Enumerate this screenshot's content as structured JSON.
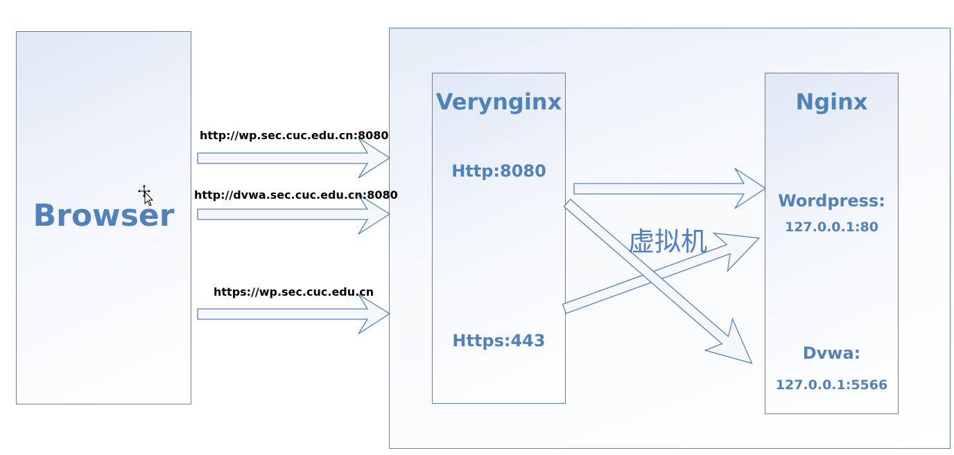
{
  "browser": {
    "label": "Browser"
  },
  "vm": {
    "label": "虚拟机"
  },
  "verynginx": {
    "title": "Verynginx",
    "http_port": "Http:8080",
    "https_port": "Https:443"
  },
  "nginx": {
    "title": "Nginx",
    "wordpress_label": "Wordpress:",
    "wordpress_addr": "127.0.0.1:80",
    "dvwa_label": "Dvwa:",
    "dvwa_addr": "127.0.0.1:5566"
  },
  "requests": [
    {
      "url": "http://wp.sec.cuc.edu.cn:8080"
    },
    {
      "url": "http://dvwa.sec.cuc.edu.cn:8080"
    },
    {
      "url": "https://wp.sec.cuc.edu.cn"
    }
  ],
  "colors": {
    "accent": "#4f81bd",
    "text": "#000000"
  },
  "icons": {
    "cursor": "move-cursor-icon"
  }
}
